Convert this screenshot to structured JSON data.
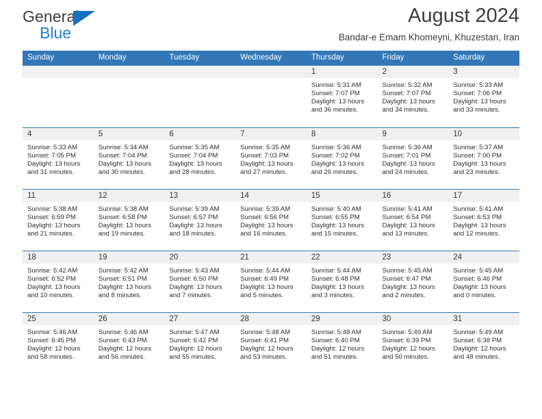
{
  "logo": {
    "word_top": "General",
    "word_bottom": "Blue",
    "triangle_icon": "blue-triangle-icon",
    "colors": {
      "general_text": "#3c3c3b",
      "blue_text": "#1c7fd4",
      "triangle": "#1670bf"
    }
  },
  "header": {
    "title": "August 2024",
    "subtitle": "Bandar-e Emam Khomeyni, Khuzestan, Iran"
  },
  "theme": {
    "header_blue": "#3277b8",
    "daynum_band": "#f0f0f0",
    "text": "#2c2c2c"
  },
  "weekdays": [
    "Sunday",
    "Monday",
    "Tuesday",
    "Wednesday",
    "Thursday",
    "Friday",
    "Saturday"
  ],
  "labels": {
    "sunrise": "Sunrise:",
    "sunset": "Sunset:",
    "daylight": "Daylight:"
  },
  "weeks": [
    [
      {
        "empty": true
      },
      {
        "empty": true
      },
      {
        "empty": true
      },
      {
        "empty": true
      },
      {
        "day": "1",
        "sunrise": "Sunrise: 5:31 AM",
        "sunset": "Sunset: 7:07 PM",
        "daylight_1": "Daylight: 13 hours",
        "daylight_2": "and 36 minutes."
      },
      {
        "day": "2",
        "sunrise": "Sunrise: 5:32 AM",
        "sunset": "Sunset: 7:07 PM",
        "daylight_1": "Daylight: 13 hours",
        "daylight_2": "and 34 minutes."
      },
      {
        "day": "3",
        "sunrise": "Sunrise: 5:33 AM",
        "sunset": "Sunset: 7:06 PM",
        "daylight_1": "Daylight: 13 hours",
        "daylight_2": "and 33 minutes."
      }
    ],
    [
      {
        "day": "4",
        "sunrise": "Sunrise: 5:33 AM",
        "sunset": "Sunset: 7:05 PM",
        "daylight_1": "Daylight: 13 hours",
        "daylight_2": "and 31 minutes."
      },
      {
        "day": "5",
        "sunrise": "Sunrise: 5:34 AM",
        "sunset": "Sunset: 7:04 PM",
        "daylight_1": "Daylight: 13 hours",
        "daylight_2": "and 30 minutes."
      },
      {
        "day": "6",
        "sunrise": "Sunrise: 5:35 AM",
        "sunset": "Sunset: 7:04 PM",
        "daylight_1": "Daylight: 13 hours",
        "daylight_2": "and 28 minutes."
      },
      {
        "day": "7",
        "sunrise": "Sunrise: 5:35 AM",
        "sunset": "Sunset: 7:03 PM",
        "daylight_1": "Daylight: 13 hours",
        "daylight_2": "and 27 minutes."
      },
      {
        "day": "8",
        "sunrise": "Sunrise: 5:36 AM",
        "sunset": "Sunset: 7:02 PM",
        "daylight_1": "Daylight: 13 hours",
        "daylight_2": "and 26 minutes."
      },
      {
        "day": "9",
        "sunrise": "Sunrise: 5:36 AM",
        "sunset": "Sunset: 7:01 PM",
        "daylight_1": "Daylight: 13 hours",
        "daylight_2": "and 24 minutes."
      },
      {
        "day": "10",
        "sunrise": "Sunrise: 5:37 AM",
        "sunset": "Sunset: 7:00 PM",
        "daylight_1": "Daylight: 13 hours",
        "daylight_2": "and 23 minutes."
      }
    ],
    [
      {
        "day": "11",
        "sunrise": "Sunrise: 5:38 AM",
        "sunset": "Sunset: 6:59 PM",
        "daylight_1": "Daylight: 13 hours",
        "daylight_2": "and 21 minutes."
      },
      {
        "day": "12",
        "sunrise": "Sunrise: 5:38 AM",
        "sunset": "Sunset: 6:58 PM",
        "daylight_1": "Daylight: 13 hours",
        "daylight_2": "and 19 minutes."
      },
      {
        "day": "13",
        "sunrise": "Sunrise: 5:39 AM",
        "sunset": "Sunset: 6:57 PM",
        "daylight_1": "Daylight: 13 hours",
        "daylight_2": "and 18 minutes."
      },
      {
        "day": "14",
        "sunrise": "Sunrise: 5:39 AM",
        "sunset": "Sunset: 6:56 PM",
        "daylight_1": "Daylight: 13 hours",
        "daylight_2": "and 16 minutes."
      },
      {
        "day": "15",
        "sunrise": "Sunrise: 5:40 AM",
        "sunset": "Sunset: 6:55 PM",
        "daylight_1": "Daylight: 13 hours",
        "daylight_2": "and 15 minutes."
      },
      {
        "day": "16",
        "sunrise": "Sunrise: 5:41 AM",
        "sunset": "Sunset: 6:54 PM",
        "daylight_1": "Daylight: 13 hours",
        "daylight_2": "and 13 minutes."
      },
      {
        "day": "17",
        "sunrise": "Sunrise: 5:41 AM",
        "sunset": "Sunset: 6:53 PM",
        "daylight_1": "Daylight: 13 hours",
        "daylight_2": "and 12 minutes."
      }
    ],
    [
      {
        "day": "18",
        "sunrise": "Sunrise: 5:42 AM",
        "sunset": "Sunset: 6:52 PM",
        "daylight_1": "Daylight: 13 hours",
        "daylight_2": "and 10 minutes."
      },
      {
        "day": "19",
        "sunrise": "Sunrise: 5:42 AM",
        "sunset": "Sunset: 6:51 PM",
        "daylight_1": "Daylight: 13 hours",
        "daylight_2": "and 8 minutes."
      },
      {
        "day": "20",
        "sunrise": "Sunrise: 5:43 AM",
        "sunset": "Sunset: 6:50 PM",
        "daylight_1": "Daylight: 13 hours",
        "daylight_2": "and 7 minutes."
      },
      {
        "day": "21",
        "sunrise": "Sunrise: 5:44 AM",
        "sunset": "Sunset: 6:49 PM",
        "daylight_1": "Daylight: 13 hours",
        "daylight_2": "and 5 minutes."
      },
      {
        "day": "22",
        "sunrise": "Sunrise: 5:44 AM",
        "sunset": "Sunset: 6:48 PM",
        "daylight_1": "Daylight: 13 hours",
        "daylight_2": "and 3 minutes."
      },
      {
        "day": "23",
        "sunrise": "Sunrise: 5:45 AM",
        "sunset": "Sunset: 6:47 PM",
        "daylight_1": "Daylight: 13 hours",
        "daylight_2": "and 2 minutes."
      },
      {
        "day": "24",
        "sunrise": "Sunrise: 5:45 AM",
        "sunset": "Sunset: 6:46 PM",
        "daylight_1": "Daylight: 13 hours",
        "daylight_2": "and 0 minutes."
      }
    ],
    [
      {
        "day": "25",
        "sunrise": "Sunrise: 5:46 AM",
        "sunset": "Sunset: 6:45 PM",
        "daylight_1": "Daylight: 12 hours",
        "daylight_2": "and 58 minutes."
      },
      {
        "day": "26",
        "sunrise": "Sunrise: 5:46 AM",
        "sunset": "Sunset: 6:43 PM",
        "daylight_1": "Daylight: 12 hours",
        "daylight_2": "and 56 minutes."
      },
      {
        "day": "27",
        "sunrise": "Sunrise: 5:47 AM",
        "sunset": "Sunset: 6:42 PM",
        "daylight_1": "Daylight: 12 hours",
        "daylight_2": "and 55 minutes."
      },
      {
        "day": "28",
        "sunrise": "Sunrise: 5:48 AM",
        "sunset": "Sunset: 6:41 PM",
        "daylight_1": "Daylight: 12 hours",
        "daylight_2": "and 53 minutes."
      },
      {
        "day": "29",
        "sunrise": "Sunrise: 5:48 AM",
        "sunset": "Sunset: 6:40 PM",
        "daylight_1": "Daylight: 12 hours",
        "daylight_2": "and 51 minutes."
      },
      {
        "day": "30",
        "sunrise": "Sunrise: 5:49 AM",
        "sunset": "Sunset: 6:39 PM",
        "daylight_1": "Daylight: 12 hours",
        "daylight_2": "and 50 minutes."
      },
      {
        "day": "31",
        "sunrise": "Sunrise: 5:49 AM",
        "sunset": "Sunset: 6:38 PM",
        "daylight_1": "Daylight: 12 hours",
        "daylight_2": "and 48 minutes."
      }
    ]
  ]
}
